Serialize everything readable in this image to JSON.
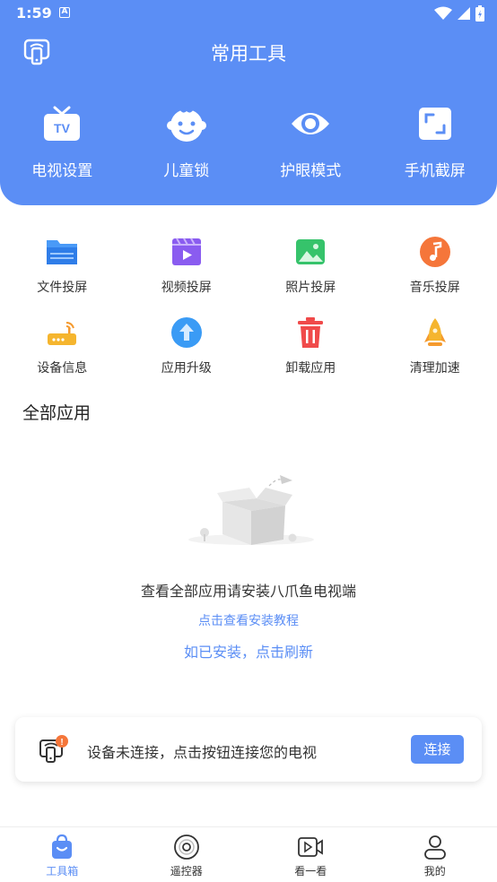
{
  "status_bar": {
    "time": "1:59",
    "notification_letter": "A"
  },
  "header": {
    "title": "常用工具",
    "quick_actions": [
      {
        "label": "电视设置",
        "icon": "tv-icon"
      },
      {
        "label": "儿童锁",
        "icon": "child-face-icon"
      },
      {
        "label": "护眼模式",
        "icon": "eye-icon"
      },
      {
        "label": "手机截屏",
        "icon": "screenshot-icon"
      }
    ]
  },
  "tools": [
    {
      "label": "文件投屏",
      "icon": "folder-icon",
      "color": "#3d8ff5"
    },
    {
      "label": "视频投屏",
      "icon": "video-icon",
      "color": "#8a5cf0"
    },
    {
      "label": "照片投屏",
      "icon": "photo-icon",
      "color": "#36c36b"
    },
    {
      "label": "音乐投屏",
      "icon": "music-icon",
      "color": "#f5763a"
    },
    {
      "label": "设备信息",
      "icon": "router-icon",
      "color": "#f5b52e"
    },
    {
      "label": "应用升级",
      "icon": "upgrade-icon",
      "color": "#3a9bf5"
    },
    {
      "label": "卸载应用",
      "icon": "trash-icon",
      "color": "#f04a4a"
    },
    {
      "label": "清理加速",
      "icon": "rocket-icon",
      "color": "#f5b52e"
    }
  ],
  "all_apps": {
    "title": "全部应用",
    "empty_message": "查看全部应用请安装八爪鱼电视端",
    "tutorial_link": "点击查看安装教程",
    "refresh_link": "如已安装，点击刷新"
  },
  "connect_card": {
    "message": "设备未连接，点击按钮连接您的电视",
    "button_label": "连接",
    "badge": "!"
  },
  "bottom_nav": [
    {
      "label": "工具箱",
      "icon": "toolbox-icon",
      "active": true
    },
    {
      "label": "遥控器",
      "icon": "remote-icon",
      "active": false
    },
    {
      "label": "看一看",
      "icon": "video-camera-icon",
      "active": false
    },
    {
      "label": "我的",
      "icon": "profile-icon",
      "active": false
    }
  ],
  "colors": {
    "primary": "#5b8ef5",
    "text": "#333333"
  }
}
